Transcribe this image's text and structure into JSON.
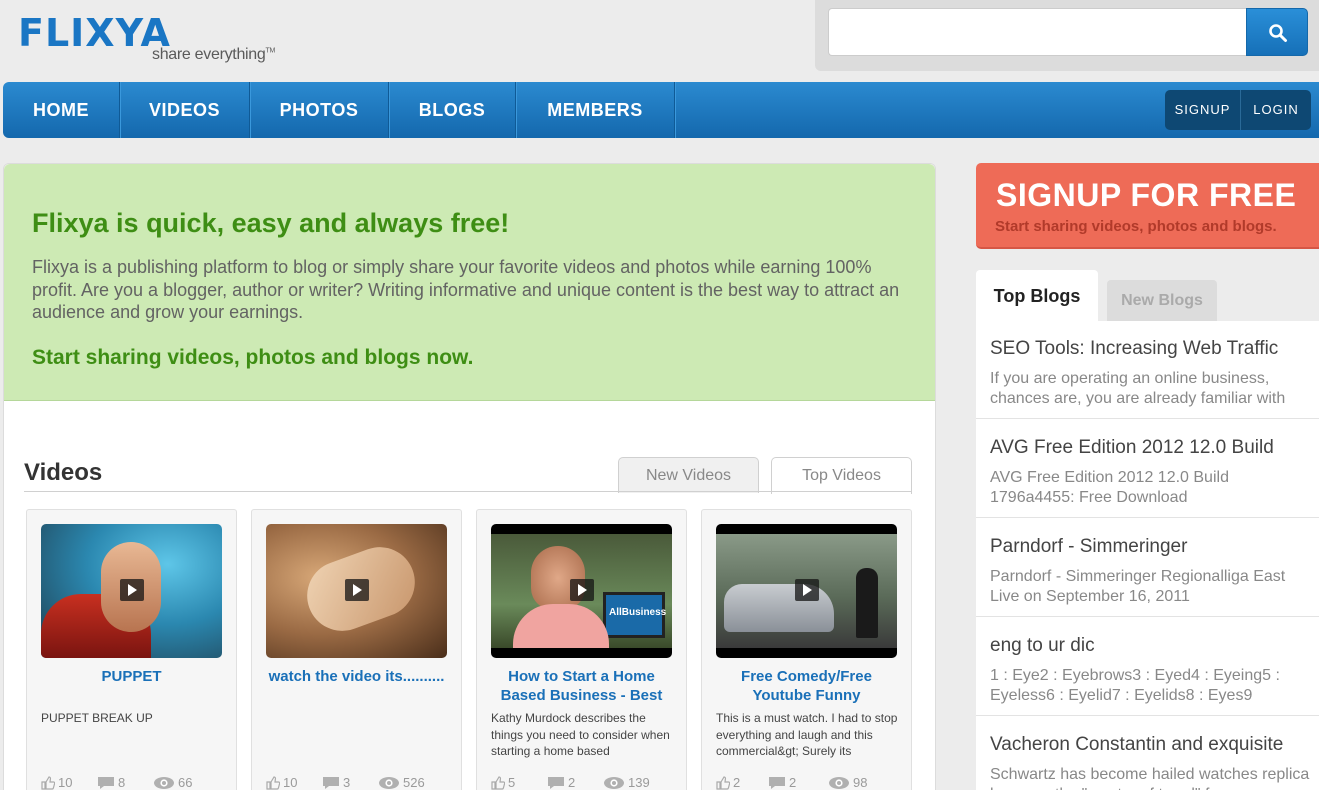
{
  "logo": {
    "word": "FLIXYA",
    "tagline": "share everything",
    "tm": "TM"
  },
  "search": {
    "value": "",
    "placeholder": "",
    "icon": "search-icon"
  },
  "nav": {
    "items": [
      "HOME",
      "VIDEOS",
      "PHOTOS",
      "BLOGS",
      "MEMBERS"
    ],
    "signup": "SIGNUP",
    "login": "LOGIN"
  },
  "hero": {
    "title": "Flixya is quick, easy and always free!",
    "text": "Flixya is a publishing platform to blog or simply share your favorite videos and photos while earning 100% profit. Are you a blogger, author or writer? Writing informative and unique content is the best way to attract an audience and grow your earnings.",
    "cta": "Start sharing videos, photos and blogs now."
  },
  "videos": {
    "heading": "Videos",
    "tabs": [
      "New Videos",
      "Top Videos"
    ],
    "items": [
      {
        "title": "PUPPET",
        "desc": "PUPPET BREAK UP",
        "likes": "10",
        "comments": "8",
        "views": "66"
      },
      {
        "title": "watch the video its..........",
        "desc": "",
        "likes": "10",
        "comments": "3",
        "views": "526"
      },
      {
        "title": "How to Start a Home Based Business - Best",
        "desc": "Kathy Murdock describes the things you need to consider when starting a home based",
        "likes": "5",
        "comments": "2",
        "views": "139"
      },
      {
        "title": "Free Comedy/Free Youtube Funny",
        "desc": "This is a must watch. I had to stop everything and laugh and this commercial&gt; Surely its",
        "likes": "2",
        "comments": "2",
        "views": "98"
      }
    ],
    "thumb_text": "AllBusiness"
  },
  "signup_box": {
    "title": "SIGNUP FOR FREE",
    "subtitle": "Start sharing videos, photos and blogs."
  },
  "blogs": {
    "tabs": [
      "Top Blogs",
      "New Blogs"
    ],
    "items": [
      {
        "title": "SEO Tools: Increasing Web Traffic",
        "snippet": "If you are operating an online business, chances are, you are already familiar with"
      },
      {
        "title": "AVG Free Edition 2012 12.0 Build",
        "snippet": "AVG Free Edition 2012 12.0 Build 1796a4455: Free Download"
      },
      {
        "title": "Parndorf - Simmeringer",
        "snippet": "Parndorf - Simmeringer Regionalliga East Live on September 16, 2011"
      },
      {
        "title": "eng to ur dic",
        "snippet": "1 : Eye2 : Eyebrows3 : Eyed4 : Eyeing5 : Eyeless6 : Eyelid7 : Eyelids8 : Eyes9"
      },
      {
        "title": "Vacheron Constantin and exquisite",
        "snippet": "Schwartz has become hailed watches replica because the \"master of trend\" for"
      }
    ]
  },
  "colors": {
    "brand_blue": "#1a76c4",
    "nav_blue": "#1c7bc2",
    "hero_green_bg": "#cdeab4",
    "hero_green_text": "#3e8e14",
    "signup_red": "#ee6b57",
    "link_blue": "#1a70b8"
  }
}
